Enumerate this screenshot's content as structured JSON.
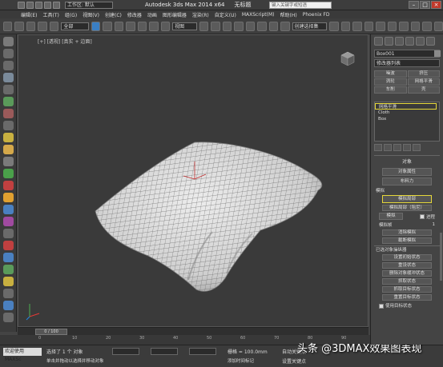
{
  "titlebar": {
    "workspace": "工作区: 默认",
    "app_title": "Autodesk 3ds Max  2014 x64",
    "doc_title": "无标题",
    "search_placeholder": "键入关键字或短语",
    "min": "–",
    "max": "□",
    "close": "×"
  },
  "menubar": {
    "items": [
      "编辑(E)",
      "工具(T)",
      "组(G)",
      "视图(V)",
      "创建(C)",
      "修改器",
      "动画",
      "图形编辑器",
      "渲染(R)",
      "自定义(U)",
      "MAXScript(M)",
      "帮助(H)",
      "Phoenix FD"
    ]
  },
  "toolbar": {
    "selection_filter": "全部",
    "ref_coord": "视图",
    "named_sel": "创建选择集"
  },
  "viewport": {
    "label": "[+] [透视] [真实 + 边面]"
  },
  "timeline": {
    "slider": "0 / 100",
    "ticks": [
      "0",
      "10",
      "20",
      "30",
      "40",
      "50",
      "60",
      "70",
      "80",
      "90",
      "100"
    ]
  },
  "status": {
    "welcome": "欢迎使用 MAXSc",
    "selection": "选择了 1 个 对象",
    "hint": "单击并拖动以选择并移动对象",
    "grid": "栅格 = 100.0mm",
    "add_tag": "添加时间标记",
    "auto_key": "自动关键点",
    "set_key": "设置关键点",
    "key_filter": "关键点过滤器..."
  },
  "command_panel": {
    "object_name": "Box001",
    "modifier_list": "修改器列表",
    "quick_buttons": [
      "噪波",
      "挤压",
      "涡轮",
      "网格平滑",
      "车削",
      "壳"
    ],
    "stack": [
      "网格平滑",
      "Cloth",
      "Box"
    ],
    "object_rollout": "对象",
    "object_props": "对象属性",
    "cloth_forces": "布料力",
    "sim_label": "模拟",
    "sim_local": "模拟局部",
    "sim_local_damped": "模拟局部（阻尼）",
    "simulate": "模拟",
    "progress": "进程",
    "sim_frame_label": "模拟帧",
    "sim_frame_value": "1",
    "erase_sim": "消除模拟",
    "truncate_sim": "截断模拟",
    "selected_obj_label": "已选对象操纵器",
    "btns": [
      "设置初始状态",
      "重设状态",
      "删除对象缓冲状态",
      "抓取状态",
      "抓取目标状态",
      "重置目标状态"
    ],
    "use_target": "使用目标状态"
  },
  "watermark": "头条 @3DMAX效果图表现"
}
